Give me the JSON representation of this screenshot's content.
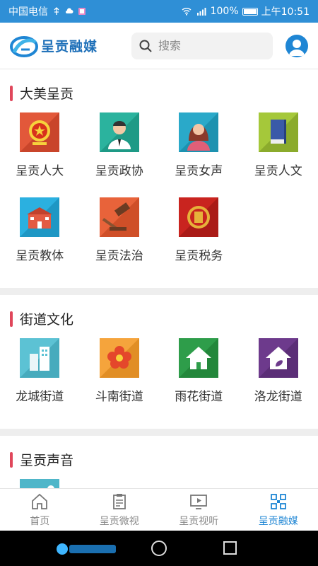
{
  "status_bar": {
    "carrier": "中国电信",
    "battery": "100%",
    "time": "上午10:51"
  },
  "header": {
    "logo_text": "呈贡融媒",
    "search_placeholder": "搜索"
  },
  "sections": [
    {
      "title": "大美呈贡",
      "items": [
        {
          "label": "呈贡人大",
          "icon": "emblem-icon"
        },
        {
          "label": "呈贡政协",
          "icon": "official-icon"
        },
        {
          "label": "呈贡女声",
          "icon": "woman-icon"
        },
        {
          "label": "呈贡人文",
          "icon": "book-icon"
        },
        {
          "label": "呈贡教体",
          "icon": "school-icon"
        },
        {
          "label": "呈贡法治",
          "icon": "gavel-icon"
        },
        {
          "label": "呈贡税务",
          "icon": "tax-emblem-icon"
        }
      ]
    },
    {
      "title": "街道文化",
      "items": [
        {
          "label": "龙城街道",
          "icon": "buildings-icon"
        },
        {
          "label": "斗南街道",
          "icon": "flower-icon"
        },
        {
          "label": "雨花街道",
          "icon": "house-icon"
        },
        {
          "label": "洛龙街道",
          "icon": "eco-house-icon"
        }
      ]
    },
    {
      "title": "呈贡声音",
      "items": [
        {
          "label": "",
          "icon": "landscape-icon"
        }
      ]
    }
  ],
  "bottom_nav": [
    {
      "label": "首页",
      "icon": "home-icon"
    },
    {
      "label": "呈贡微视",
      "icon": "clipboard-icon"
    },
    {
      "label": "呈贡视听",
      "icon": "video-screen-icon"
    },
    {
      "label": "呈贡融媒",
      "icon": "grid-icon",
      "active": true
    }
  ],
  "colors": {
    "accent": "#1f86d4",
    "section_bar": "#e0475b"
  }
}
